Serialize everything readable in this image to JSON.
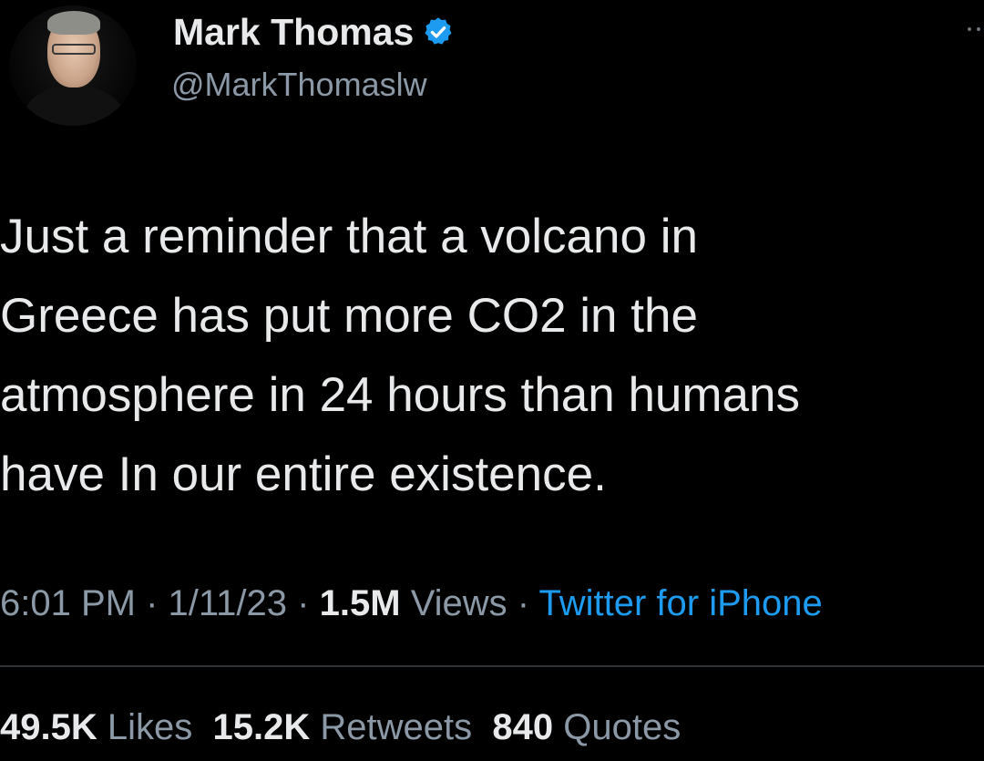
{
  "author": {
    "name": "Mark Thomas",
    "handle": "@MarkThomaslw",
    "verified": true
  },
  "tweet": {
    "lines": [
      "Just a reminder that a volcano in",
      "Greece has put more CO2 in the",
      "atmosphere in 24 hours than humans",
      "have In our entire existence."
    ]
  },
  "meta": {
    "time": "6:01 PM",
    "date": "1/11/23",
    "views_count": "1.5M",
    "views_label": "Views",
    "separator": "·",
    "source": "Twitter for iPhone"
  },
  "stats": {
    "likes_count": "49.5K",
    "likes_label": "Likes",
    "retweets_count": "15.2K",
    "retweets_label": "Retweets",
    "quotes_count": "840",
    "quotes_label": "Quotes"
  },
  "colors": {
    "background": "#000000",
    "text": "#e7e9ea",
    "secondary": "#8b98a5",
    "accent": "#1d9bf0",
    "divider": "#2f3336"
  },
  "icons": {
    "verified": "verified-badge-icon",
    "more": "more-options-icon"
  }
}
